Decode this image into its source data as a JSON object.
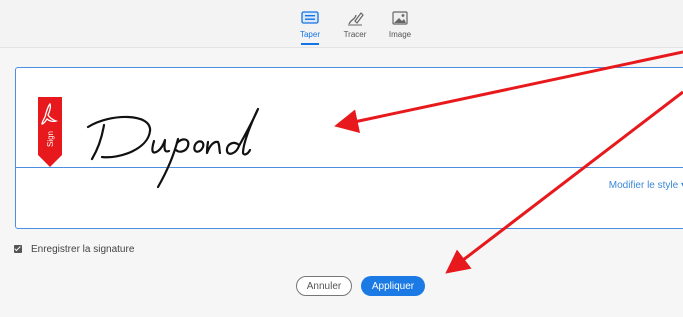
{
  "tabs": [
    {
      "label": "Taper",
      "icon": "keyboard-icon",
      "active": true
    },
    {
      "label": "Tracer",
      "icon": "pen-draw-icon",
      "active": false
    },
    {
      "label": "Image",
      "icon": "image-icon",
      "active": false
    }
  ],
  "signature": {
    "text": "Dupond",
    "badge_label": "Sign",
    "modify_style": "Modifier le style ▾"
  },
  "save_signature": {
    "label": "Enregistrer la signature",
    "checked": true
  },
  "buttons": {
    "cancel": "Annuler",
    "apply": "Appliquer"
  },
  "colors": {
    "accent": "#1473e6",
    "arrow": "#e8191c",
    "badge": "#e8191c"
  }
}
